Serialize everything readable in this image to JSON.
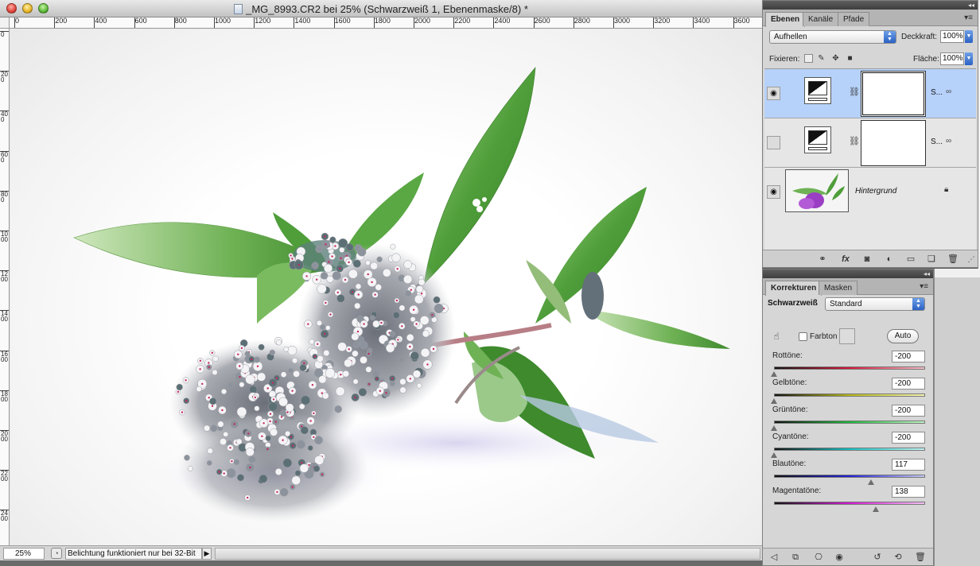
{
  "document": {
    "title": "_MG_8993.CR2 bei 25% (Schwarzweiß 1, Ebenenmaske/8) *",
    "ruler_top_ticks": [
      "0",
      "200",
      "400",
      "600",
      "800",
      "1000",
      "1200",
      "1400",
      "1600",
      "1800",
      "2000",
      "2200",
      "2400",
      "2600",
      "2800",
      "3000",
      "3200",
      "3400",
      "3600"
    ],
    "ruler_left_ticks": [
      "0",
      "200",
      "400",
      "600",
      "800",
      "1000",
      "1200",
      "1400",
      "1600",
      "1800",
      "2000",
      "2200",
      "2400"
    ],
    "zoom": "25%",
    "status_text": "Belichtung funktioniert nur bei 32-Bit",
    "status_arrow": "▶"
  },
  "colors": {
    "leaf": "#4f9e3a",
    "leaf_light": "#8cc46e",
    "selection_blue": "#b6d2fa",
    "accent_blue": "#2a61c4"
  },
  "layers_panel": {
    "tabs": [
      "Ebenen",
      "Kanäle",
      "Pfade"
    ],
    "active_tab": "Ebenen",
    "blend_mode": "Aufhellen",
    "opacity_label": "Deckkraft:",
    "opacity_value": "100%",
    "lock_label": "Fixieren:",
    "fill_label": "Fläche:",
    "fill_value": "100%",
    "layers": [
      {
        "name": "S...",
        "type": "adjustment",
        "visible": true,
        "selected": true
      },
      {
        "name": "S...",
        "type": "adjustment",
        "visible": false,
        "selected": false
      },
      {
        "name": "Hintergrund",
        "type": "background",
        "visible": true,
        "selected": false
      }
    ],
    "footer_icons": [
      "link-icon",
      "fx-icon",
      "mask-icon",
      "adjustment-icon",
      "group-icon",
      "new-layer-icon",
      "trash-icon"
    ]
  },
  "corrections_panel": {
    "tabs": [
      "Korrekturen",
      "Masken"
    ],
    "active_tab": "Korrekturen",
    "adjustment_name": "Schwarzweiß",
    "preset": "Standard",
    "tint_label": "Farbton",
    "auto_label": "Auto",
    "sliders": [
      {
        "label": "Rottöne:",
        "value": "-200",
        "fraction": 0.0,
        "gradient": "linear-gradient(to right, #111, #d8183a, #f5c0c8)"
      },
      {
        "label": "Gelbtöne:",
        "value": "-200",
        "fraction": 0.0,
        "gradient": "linear-gradient(to right, #111, #b8b81a, #f7f7b0)"
      },
      {
        "label": "Grüntöne:",
        "value": "-200",
        "fraction": 0.0,
        "gradient": "linear-gradient(to right, #111, #1cb83a, #bff5c4)"
      },
      {
        "label": "Cyantöne:",
        "value": "-200",
        "fraction": 0.0,
        "gradient": "linear-gradient(to right, #111, #18c0c0, #c0f5f5)"
      },
      {
        "label": "Blautöne:",
        "value": "117",
        "fraction": 0.648,
        "gradient": "linear-gradient(to right, #111, #2222d8, #c8c8f5)"
      },
      {
        "label": "Magentatöne:",
        "value": "138",
        "fraction": 0.681,
        "gradient": "linear-gradient(to right, #111, #d41ad4, #f5c0f5)"
      }
    ],
    "footer_icons": [
      "back-icon",
      "expand-view-icon",
      "clip-icon",
      "visibility-icon",
      "previous-state-icon",
      "reset-icon",
      "trash-icon"
    ]
  }
}
